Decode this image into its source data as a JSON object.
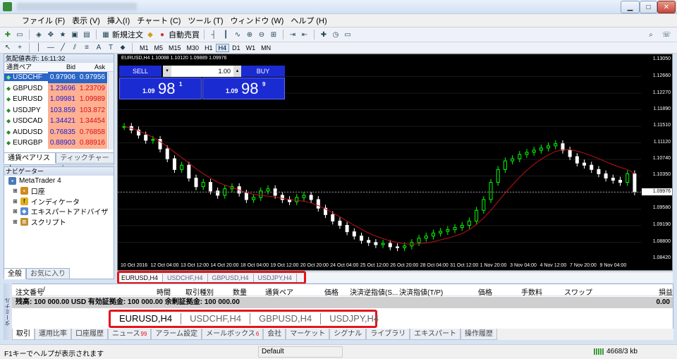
{
  "window": {
    "buttons": {
      "minimize": "▁",
      "maximize": "□",
      "close": "✕"
    }
  },
  "menu": [
    "ファイル (F)",
    "表示 (V)",
    "挿入(I)",
    "チャート (C)",
    "ツール (T)",
    "ウィンドウ (W)",
    "ヘルプ (H)"
  ],
  "toolbar": {
    "new_order": "新規注文",
    "auto_trading": "自動売買"
  },
  "timeframes": [
    "M1",
    "M5",
    "M15",
    "M30",
    "H1",
    "H4",
    "D1",
    "W1",
    "MN"
  ],
  "active_timeframe": "H4",
  "market_watch": {
    "header": "気配値表示: 16:11:32",
    "columns": {
      "symbol": "通貨ペア",
      "bid": "Bid",
      "ask": "Ask"
    },
    "rows": [
      {
        "symbol": "USDCHF",
        "bid": "0.97906",
        "ask": "0.97956",
        "selected": true,
        "bg": "#2a66c7"
      },
      {
        "symbol": "GBPUSD",
        "bid": "1.23696",
        "ask": "1.23709",
        "bg": "#ffb090"
      },
      {
        "symbol": "EURUSD",
        "bid": "1.09981",
        "ask": "1.09989",
        "bg": "#ffb090"
      },
      {
        "symbol": "USDJPY",
        "bid": "103.859",
        "ask": "103.872",
        "bg": "#ffb090"
      },
      {
        "symbol": "USDCAD",
        "bid": "1.34421",
        "ask": "1.34454",
        "bg": "#ffb090"
      },
      {
        "symbol": "AUDUSD",
        "bid": "0.76835",
        "ask": "0.76858",
        "bg": "#ffb090"
      },
      {
        "symbol": "EURGBP",
        "bid": "0.88903",
        "ask": "0.88916",
        "bg": "#ffb090"
      }
    ],
    "tabs": [
      "通貨ペアリスト",
      "ティックチャート"
    ]
  },
  "navigator": {
    "header": "ナビゲーター",
    "root": "MetaTrader 4",
    "items": [
      "口座",
      "インディケータ",
      "エキスパートアドバイザ",
      "スクリプト"
    ],
    "tabs": [
      "全般",
      "お気に入り"
    ]
  },
  "chart": {
    "header": "EURUSD,H4  1.10088 1.10120 1.09889 1.09976",
    "trade": {
      "sell": "SELL",
      "buy": "BUY",
      "lots": "1.00",
      "bid_prefix": "1.09",
      "bid_big": "98",
      "bid_sup": "1",
      "ask_prefix": "1.09",
      "ask_big": "98",
      "ask_sup": "9"
    },
    "current_price": "1.09976"
  },
  "chart_data": {
    "type": "candlestick",
    "symbol": "EURUSD",
    "timeframe": "H4",
    "price_ticks": [
      "1.13050",
      "1.12660",
      "1.12270",
      "1.11890",
      "1.11510",
      "1.11120",
      "1.10740",
      "1.10350",
      "1.09976",
      "1.09580",
      "1.09190",
      "1.08800",
      "1.08420"
    ],
    "time_ticks": [
      "10 Oct 2016",
      "12 Oct 04:00",
      "13 Oct 12:00",
      "14 Oct 20:00",
      "18 Oct 04:00",
      "19 Oct 12:00",
      "20 Oct 20:00",
      "24 Oct 04:00",
      "25 Oct 12:00",
      "26 Oct 20:00",
      "28 Oct 04:00",
      "31 Oct 12:00",
      "1 Nov 20:00",
      "3 Nov 04:00",
      "4 Nov 12:00",
      "7 Nov 20:00",
      "9 Nov 04:00"
    ],
    "ylim": [
      1.0842,
      1.1305
    ],
    "close": [
      1.115,
      1.1142,
      1.113,
      1.1118,
      1.112,
      1.1098,
      1.1075,
      1.105,
      1.106,
      1.103,
      1.101,
      1.102,
      1.1,
      1.099,
      1.1005,
      1.101,
      1.0995,
      1.098,
      1.0985,
      1.1,
      1.1005,
      1.099,
      1.098,
      1.0975,
      1.0985,
      1.099,
      1.098,
      1.096,
      1.0945,
      1.093,
      1.092,
      1.0905,
      1.0895,
      1.0885,
      1.088,
      1.0875,
      1.0878,
      1.087,
      1.0868,
      1.0872,
      1.088,
      1.089,
      1.0895,
      1.0902,
      1.0906,
      1.091,
      1.0915,
      1.092,
      1.093,
      1.0955,
      1.098,
      1.102,
      1.105,
      1.107,
      1.1075,
      1.1085,
      1.109,
      1.1095,
      1.11,
      1.1105,
      1.111,
      1.1095,
      1.108,
      1.1065,
      1.106,
      1.105,
      1.104,
      1.103,
      1.1025,
      1.102,
      1.104,
      1.0998
    ],
    "ma": [
      1.115,
      1.1146,
      1.114,
      1.1133,
      1.1125,
      1.1115,
      1.1103,
      1.109,
      1.1078,
      1.1065,
      1.1052,
      1.104,
      1.103,
      1.102,
      1.1014,
      1.1008,
      1.1002,
      1.0996,
      1.0992,
      1.099,
      1.0988,
      1.0986,
      1.0983,
      1.098,
      1.0978,
      1.0976,
      1.0972,
      1.0966,
      1.0958,
      1.0949,
      1.094,
      1.093,
      1.092,
      1.0911,
      1.0902,
      1.0895,
      1.0889,
      1.0884,
      1.088,
      1.0877,
      1.0876,
      1.0877,
      1.0879,
      1.0882,
      1.0886,
      1.089,
      1.0895,
      1.0901,
      1.091,
      1.0922,
      1.0937,
      1.0955,
      1.0975,
      1.0995,
      1.1014,
      1.1032,
      1.1048,
      1.1062,
      1.1074,
      1.1084,
      1.1092,
      1.1096,
      1.1096,
      1.1093,
      1.1088,
      1.1082,
      1.1075,
      1.1068,
      1.1061,
      1.1055,
      1.105,
      1.104
    ]
  },
  "chart_tabs": [
    "EURUSD,H4",
    "USDCHF,H4",
    "GBPUSD,H4",
    "USDJPY,H4"
  ],
  "terminal": {
    "side_label": "ターミナル",
    "columns": [
      "注文番号",
      "/",
      "時間",
      "取引種別",
      "数量",
      "通貨ペア",
      "価格",
      "決済逆指値(S...",
      "決済指値(T/P)",
      "価格",
      "手数料",
      "スワップ",
      "損益"
    ],
    "balance": "残高: 100 000.00 USD  有効証拠金: 100 000.00  余剰証拠金: 100 000.00",
    "total": "0.00",
    "tabs": [
      {
        "label": "取引",
        "active": true
      },
      {
        "label": "運用比率"
      },
      {
        "label": "口座履歴"
      },
      {
        "label": "ニュース",
        "badge": "99"
      },
      {
        "label": "アラーム設定"
      },
      {
        "label": "メールボックス",
        "badge": "6"
      },
      {
        "label": "会社"
      },
      {
        "label": "マーケット"
      },
      {
        "label": "シグナル"
      },
      {
        "label": "ライブラリ"
      },
      {
        "label": "エキスパート"
      },
      {
        "label": "操作履歴"
      }
    ]
  },
  "status": {
    "help": "F1キーでヘルプが表示されます",
    "profile": "Default",
    "traffic": "4668/3 kb"
  },
  "colors": {
    "bull": "#00ff00",
    "bear": "#ffffff",
    "ma": "#c0101a",
    "highlight": "#e5141b",
    "trade_blue": "#1b2bd2"
  }
}
